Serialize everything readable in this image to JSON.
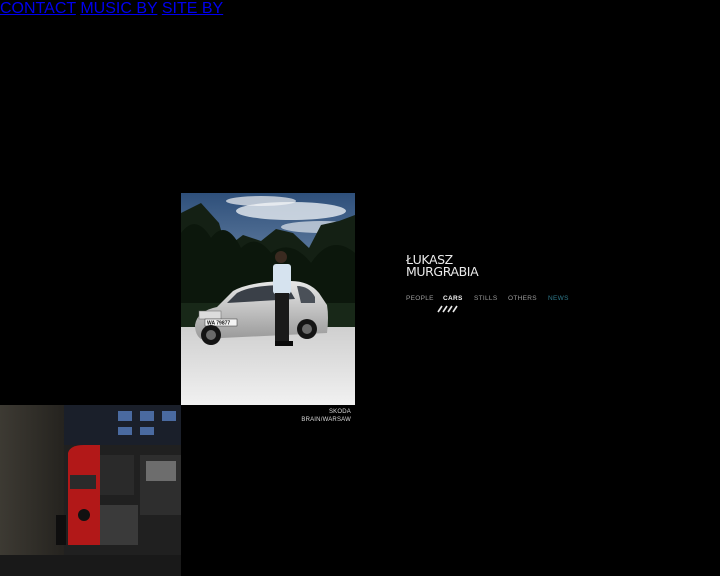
{
  "topnav": {
    "contact": "CONTACT",
    "music_by": "MUSIC BY",
    "site_by": "SITE BY"
  },
  "logo": {
    "line1": "ŁUKASZ",
    "line2": "MURGRABIA"
  },
  "categories": [
    {
      "label": "PEOPLE",
      "active": false
    },
    {
      "label": "CARS",
      "active": true
    },
    {
      "label": "STILLS",
      "active": false
    },
    {
      "label": "OTHERS",
      "active": false
    },
    {
      "label": "NEWS",
      "active": false
    }
  ],
  "featured": {
    "caption_line1": "SKODA",
    "caption_line2": "BRAIN/WARSAW",
    "license_plate": "WA 79877"
  },
  "colors": {
    "background": "#000000",
    "news_accent": "#2f7a8c",
    "active_nav": "#f2f2f2"
  }
}
